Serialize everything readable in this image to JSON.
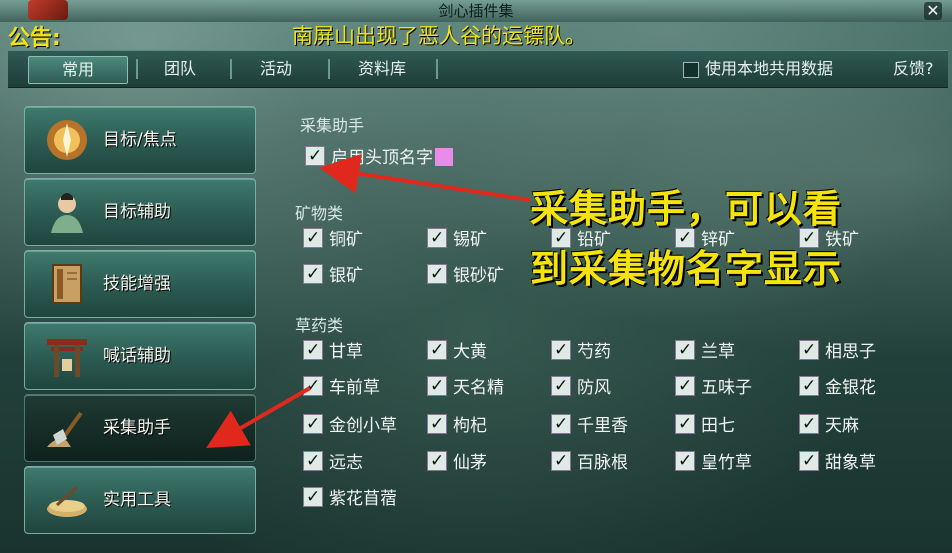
{
  "window": {
    "title": "剑心插件集",
    "close_glyph": "✕"
  },
  "notice": {
    "label": "公告:",
    "text": "南屏山出现了恶人谷的运镖队。"
  },
  "tabs": [
    {
      "label": "常用",
      "active": true
    },
    {
      "label": "团队",
      "active": false
    },
    {
      "label": "活动",
      "active": false
    },
    {
      "label": "资料库",
      "active": false
    }
  ],
  "options": {
    "local_data_label": "使用本地共用数据",
    "feedback_label": "反馈?"
  },
  "sidebar": {
    "items": [
      {
        "label": "目标/焦点",
        "icon": "target-emblem-icon",
        "active": false
      },
      {
        "label": "目标辅助",
        "icon": "character-portrait-icon",
        "active": false
      },
      {
        "label": "技能增强",
        "icon": "skill-book-icon",
        "active": false
      },
      {
        "label": "喊话辅助",
        "icon": "shrine-gate-icon",
        "active": false
      },
      {
        "label": "采集助手",
        "icon": "shovel-icon",
        "active": true
      },
      {
        "label": "实用工具",
        "icon": "tool-tray-icon",
        "active": false
      }
    ]
  },
  "panel": {
    "gather_section": "采集助手",
    "head_name_option": "启用头顶名字",
    "mineral_section": "矿物类",
    "minerals": [
      "铜矿",
      "锡矿",
      "铅矿",
      "锌矿",
      "铁矿",
      "银矿",
      "银砂矿"
    ],
    "herb_section": "草药类",
    "herbs": [
      "甘草",
      "大黄",
      "芍药",
      "兰草",
      "相思子",
      "车前草",
      "天名精",
      "防风",
      "五味子",
      "金银花",
      "金创小草",
      "枸杞",
      "千里香",
      "田七",
      "天麻",
      "远志",
      "仙茅",
      "百脉根",
      "皇竹草",
      "甜象草",
      "紫花苜蓿"
    ]
  },
  "annotation": {
    "line1": "采集助手，可以看",
    "line2": "到采集物名字显示",
    "color": "#f4e30d",
    "arrow_color": "#e0281c"
  }
}
